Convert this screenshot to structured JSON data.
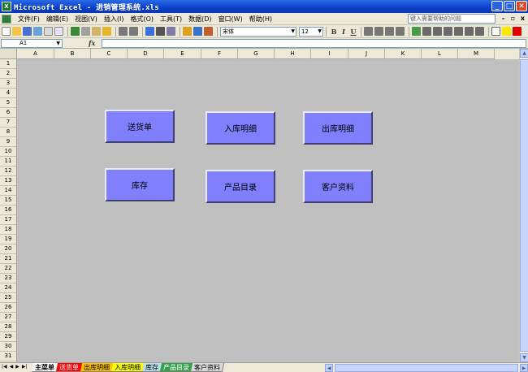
{
  "window": {
    "title": "Microsoft Excel - 进销管理系统.xls",
    "app_icon": "X",
    "controls": [
      "_",
      "□",
      "✕"
    ]
  },
  "menu": {
    "items": [
      "文件(F)",
      "编辑(E)",
      "视图(V)",
      "插入(I)",
      "格式(O)",
      "工具(T)",
      "数据(D)",
      "窗口(W)",
      "帮助(H)"
    ],
    "help_placeholder": "键入需要帮助的问题",
    "doc_controls": [
      "-",
      "▫",
      "x"
    ]
  },
  "toolbar": {
    "font_name": "宋体",
    "font_size": "12",
    "format_letters": [
      "B",
      "I",
      "U"
    ]
  },
  "formula_bar": {
    "cell_ref": "A1",
    "fx_label": "fx",
    "value": ""
  },
  "columns": [
    "A",
    "B",
    "C",
    "D",
    "E",
    "F",
    "G",
    "H",
    "I",
    "J",
    "K",
    "L",
    "M"
  ],
  "rows": [
    "1",
    "2",
    "3",
    "4",
    "5",
    "6",
    "7",
    "8",
    "9",
    "10",
    "11",
    "12",
    "13",
    "14",
    "15",
    "16",
    "17",
    "18",
    "19",
    "20",
    "21",
    "22",
    "23",
    "24",
    "25",
    "26",
    "27",
    "28",
    "29",
    "30",
    "31"
  ],
  "buttons": [
    {
      "id": "delivery",
      "label": "送货单"
    },
    {
      "id": "stock-in",
      "label": "入库明细"
    },
    {
      "id": "stock-out",
      "label": "出库明细"
    },
    {
      "id": "inventory",
      "label": "库存"
    },
    {
      "id": "catalog",
      "label": "产品目录"
    },
    {
      "id": "customers",
      "label": "客户资料"
    }
  ],
  "sheet_tabs": [
    {
      "label": "主菜单",
      "color": "#000000",
      "bg": "#ffffff",
      "active": true
    },
    {
      "label": "送货单",
      "color": "#ffffff",
      "bg": "#ff0000",
      "active": false
    },
    {
      "label": "出库明细",
      "color": "#000000",
      "bg": "#ffc000",
      "active": false
    },
    {
      "label": "入库明细",
      "color": "#000000",
      "bg": "#ffff00",
      "active": false
    },
    {
      "label": "库存",
      "color": "#000000",
      "bg": "#b7dde8",
      "active": false
    },
    {
      "label": "产品目录",
      "color": "#ffffff",
      "bg": "#33a04a",
      "active": false
    },
    {
      "label": "客户资料",
      "color": "#000000",
      "bg": "#d8d8d8",
      "active": false
    }
  ],
  "colors": {
    "button_fill": "#8080ff",
    "sheet_bg": "#c0c0c0",
    "title_blue": "#0a3fc8"
  }
}
